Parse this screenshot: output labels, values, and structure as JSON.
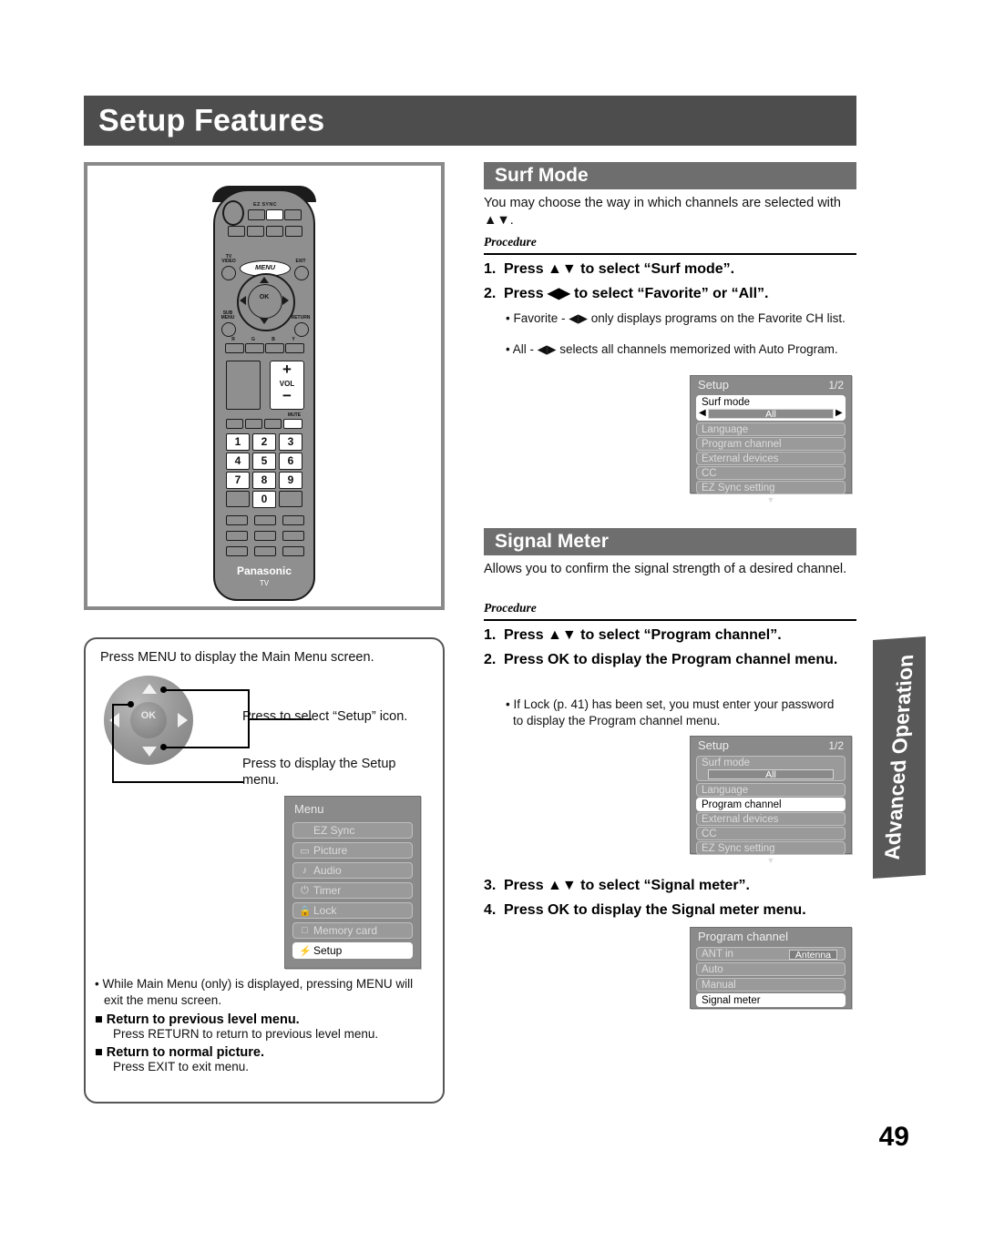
{
  "page": {
    "title": "Setup Features",
    "number": "49",
    "side_tab": "Advanced Operation"
  },
  "remote": {
    "ezsync_label": "EZ SYNC",
    "menu_label": "MENU",
    "ok_label": "OK",
    "tv_video_label": "TV\nVIDEO",
    "exit_label": "EXIT",
    "sub_menu_label": "SUB\nMENU",
    "return_label": "RETURN",
    "color_keys": [
      "R",
      "G",
      "B",
      "Y"
    ],
    "mute_label": "MUTE",
    "vol_label": "VOL",
    "vol_plus": "+",
    "vol_minus": "−",
    "keypad": [
      "1",
      "2",
      "3",
      "4",
      "5",
      "6",
      "7",
      "8",
      "9",
      "0"
    ],
    "brand": "Panasonic",
    "brand_sub": "TV"
  },
  "left_panel": {
    "intro": "Press MENU to display the Main Menu screen.",
    "callout_up": "Press to select “Setup” icon.",
    "callout_down": "Press to display the Setup menu.",
    "nav_ok_label": "OK",
    "menu_osd": {
      "title": "Menu",
      "items": [
        {
          "icon": "",
          "label": "EZ Sync",
          "selected": false
        },
        {
          "icon": "▭",
          "label": "Picture",
          "selected": false
        },
        {
          "icon": "♪",
          "label": "Audio",
          "selected": false
        },
        {
          "icon": "⏻",
          "label": "Timer",
          "selected": false
        },
        {
          "icon": "🔒",
          "label": "Lock",
          "selected": false
        },
        {
          "icon": "□",
          "label": "Memory card",
          "selected": false
        },
        {
          "icon": "⚡",
          "label": "Setup",
          "selected": true
        }
      ]
    },
    "notes": {
      "bullet": "While Main Menu (only) is displayed, pressing MENU will exit the menu screen.",
      "head1": "Return to previous level menu.",
      "sub1": "Press RETURN to return to previous level menu.",
      "head2": "Return to normal picture.",
      "sub2": "Press EXIT to exit menu."
    }
  },
  "surf_mode": {
    "heading": "Surf Mode",
    "intro": "You may choose the way in which channels are selected with ▲▼.",
    "procedure_label": "Procedure",
    "steps": [
      {
        "n": "1.",
        "text": "Press ▲▼ to select “Surf mode”."
      },
      {
        "n": "2.",
        "text": "Press ◀▶ to select “Favorite” or “All”."
      }
    ],
    "bullets": [
      "Favorite - ◀▶ only displays programs on the Favorite CH list.",
      "All - ◀▶ selects all channels memorized with Auto Program."
    ],
    "osd": {
      "title": "Setup",
      "page": "1/2",
      "rows": [
        {
          "label": "Surf mode",
          "selected": true
        },
        {
          "label": "Language",
          "selected": false
        },
        {
          "label": "Program channel",
          "selected": false
        },
        {
          "label": "External devices",
          "selected": false
        },
        {
          "label": "CC",
          "selected": false
        },
        {
          "label": "EZ Sync setting",
          "selected": false
        }
      ],
      "value": "All",
      "left_arrow": "◀",
      "right_arrow": "▶",
      "scroll_arrow": "▼"
    }
  },
  "signal_meter": {
    "heading": "Signal Meter",
    "intro": "Allows you to confirm the signal strength of a desired channel.",
    "procedure_label": "Procedure",
    "steps": [
      {
        "n": "1.",
        "text": "Press ▲▼ to select “Program channel”."
      },
      {
        "n": "2.",
        "text": "Press OK to display the Program channel menu."
      },
      {
        "n": "3.",
        "text": "Press ▲▼ to select “Signal meter”."
      },
      {
        "n": "4.",
        "text": "Press OK to display the Signal meter menu."
      }
    ],
    "bullets": [
      "If Lock (p. 41) has been set, you must enter your password to display the Program channel menu."
    ],
    "osd_setup": {
      "title": "Setup",
      "page": "1/2",
      "rows": [
        {
          "label": "Surf mode",
          "selected": false
        },
        {
          "label": "Language",
          "selected": false
        },
        {
          "label": "Program channel",
          "selected": true
        },
        {
          "label": "External devices",
          "selected": false
        },
        {
          "label": "CC",
          "selected": false
        },
        {
          "label": "EZ Sync setting",
          "selected": false
        }
      ],
      "value": "All",
      "scroll_arrow": "▼"
    },
    "osd_program_channel": {
      "title": "Program channel",
      "rows": [
        {
          "label": "ANT in",
          "value": "Antenna",
          "selected": false
        },
        {
          "label": "Auto",
          "value": "",
          "selected": false
        },
        {
          "label": "Manual",
          "value": "",
          "selected": false
        },
        {
          "label": "Signal meter",
          "value": "",
          "selected": true
        }
      ]
    }
  },
  "colors": {
    "title_band": "#4d4d4d",
    "section_band": "#6e6e6e",
    "osd_bg": "#8a8a8a",
    "osd_row": "#9a9a9a",
    "side_tab": "#585858"
  }
}
